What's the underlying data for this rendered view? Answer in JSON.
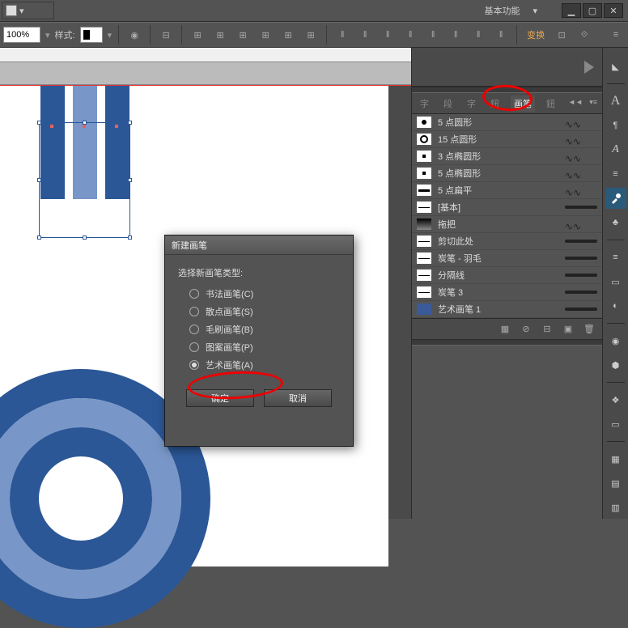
{
  "topbar": {
    "workspace": "基本功能"
  },
  "toolbar": {
    "zoom": "100%",
    "style_label": "样式:",
    "transform": "变换"
  },
  "panel": {
    "tabs": [
      "字",
      "段",
      "字",
      "鈕",
      "画笔",
      "鈕"
    ],
    "active_tab": "画笔"
  },
  "brushes": [
    {
      "name": "5 点圆形",
      "thumb": "dot"
    },
    {
      "name": "15 点圆形",
      "thumb": "ring"
    },
    {
      "name": "3 点椭圆形",
      "thumb": "sq"
    },
    {
      "name": "5 点椭圆形",
      "thumb": "sq"
    },
    {
      "name": "5 点扁平",
      "thumb": "flat"
    },
    {
      "name": "[基本]",
      "thumb": "line"
    },
    {
      "name": "拖把",
      "thumb": "grad"
    },
    {
      "name": "剪切此处",
      "thumb": "line"
    },
    {
      "name": "炭笔 - 羽毛",
      "thumb": "line"
    },
    {
      "name": "分隔线",
      "thumb": "line"
    },
    {
      "name": "炭笔 3",
      "thumb": "line"
    },
    {
      "name": "艺术画笔 1",
      "thumb": "art"
    }
  ],
  "dialog": {
    "title": "新建画笔",
    "heading": "选择新画笔类型:",
    "options": [
      "书法画笔(C)",
      "散点画笔(S)",
      "毛刷画笔(B)",
      "图案画笔(P)",
      "艺术画笔(A)"
    ],
    "selected_index": 4,
    "ok": "确定",
    "cancel": "取消"
  }
}
